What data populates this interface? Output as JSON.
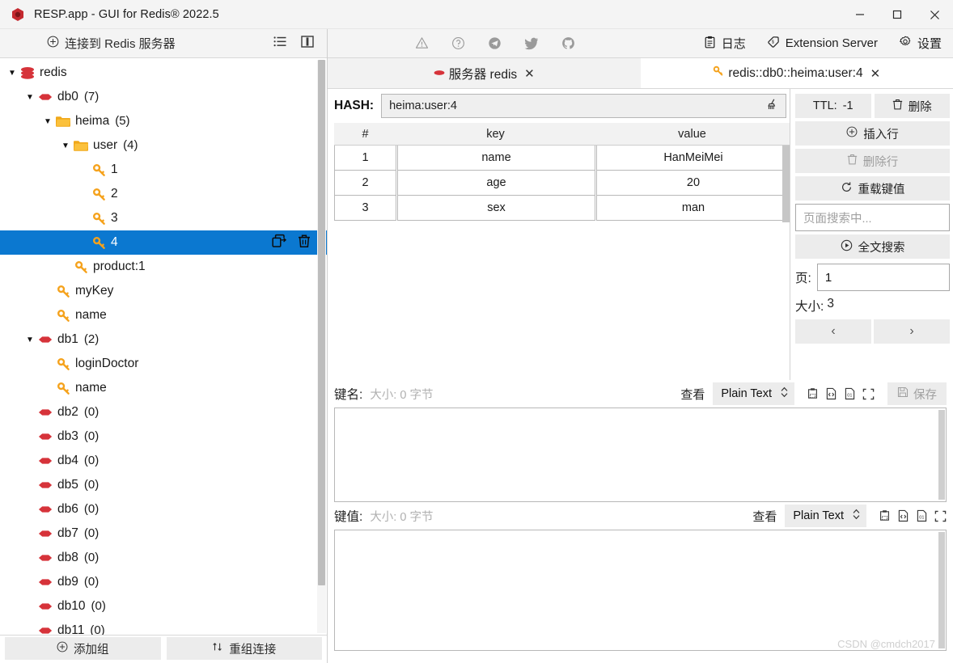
{
  "window": {
    "title": "RESP.app - GUI for Redis® 2022.5",
    "app_icon": "redis-hexagon-icon",
    "controls": {
      "minimize": "─",
      "maximize": "□",
      "close": "✕"
    }
  },
  "sidebar": {
    "connect_label": "连接到 Redis 服务器",
    "connect_icon": "plus-circle-icon",
    "head_icons": [
      "list-view-icon",
      "split-pane-icon"
    ],
    "tree": [
      {
        "label": "redis",
        "count": "",
        "depth": 0,
        "icon": "stack-icon",
        "arrow": "▼",
        "selected": false
      },
      {
        "label": "db0",
        "count": "(7)",
        "depth": 1,
        "icon": "db-icon",
        "arrow": "▼",
        "selected": false
      },
      {
        "label": "heima",
        "count": "(5)",
        "depth": 2,
        "icon": "folder-icon",
        "arrow": "▼",
        "selected": false
      },
      {
        "label": "user",
        "count": "(4)",
        "depth": 3,
        "icon": "folder-icon",
        "arrow": "▼",
        "selected": false
      },
      {
        "label": "1",
        "count": "",
        "depth": 4,
        "icon": "key-icon",
        "arrow": "",
        "selected": false
      },
      {
        "label": "2",
        "count": "",
        "depth": 4,
        "icon": "key-icon",
        "arrow": "",
        "selected": false
      },
      {
        "label": "3",
        "count": "",
        "depth": 4,
        "icon": "key-icon",
        "arrow": "",
        "selected": false
      },
      {
        "label": "4",
        "count": "",
        "depth": 4,
        "icon": "key-icon",
        "arrow": "",
        "selected": true
      },
      {
        "label": "product:1",
        "count": "",
        "depth": 3,
        "icon": "key-icon",
        "arrow": "",
        "selected": false
      },
      {
        "label": "myKey",
        "count": "",
        "depth": 2,
        "icon": "key-icon",
        "arrow": "",
        "selected": false
      },
      {
        "label": "name",
        "count": "",
        "depth": 2,
        "icon": "key-icon",
        "arrow": "",
        "selected": false
      },
      {
        "label": "db1",
        "count": "(2)",
        "depth": 1,
        "icon": "db-icon",
        "arrow": "▼",
        "selected": false
      },
      {
        "label": "loginDoctor",
        "count": "",
        "depth": 2,
        "icon": "key-icon",
        "arrow": "",
        "selected": false
      },
      {
        "label": "name",
        "count": "",
        "depth": 2,
        "icon": "key-icon",
        "arrow": "",
        "selected": false
      },
      {
        "label": "db2",
        "count": "(0)",
        "depth": 1,
        "icon": "db-icon",
        "arrow": "",
        "selected": false
      },
      {
        "label": "db3",
        "count": "(0)",
        "depth": 1,
        "icon": "db-icon",
        "arrow": "",
        "selected": false
      },
      {
        "label": "db4",
        "count": "(0)",
        "depth": 1,
        "icon": "db-icon",
        "arrow": "",
        "selected": false
      },
      {
        "label": "db5",
        "count": "(0)",
        "depth": 1,
        "icon": "db-icon",
        "arrow": "",
        "selected": false
      },
      {
        "label": "db6",
        "count": "(0)",
        "depth": 1,
        "icon": "db-icon",
        "arrow": "",
        "selected": false
      },
      {
        "label": "db7",
        "count": "(0)",
        "depth": 1,
        "icon": "db-icon",
        "arrow": "",
        "selected": false
      },
      {
        "label": "db8",
        "count": "(0)",
        "depth": 1,
        "icon": "db-icon",
        "arrow": "",
        "selected": false
      },
      {
        "label": "db9",
        "count": "(0)",
        "depth": 1,
        "icon": "db-icon",
        "arrow": "",
        "selected": false
      },
      {
        "label": "db10",
        "count": "(0)",
        "depth": 1,
        "icon": "db-icon",
        "arrow": "",
        "selected": false
      },
      {
        "label": "db11",
        "count": "(0)",
        "depth": 1,
        "icon": "db-icon",
        "arrow": "",
        "selected": false
      }
    ],
    "row_actions": [
      "duplicate-icon",
      "trash-icon"
    ],
    "footer": {
      "add_group": "添加组",
      "add_group_icon": "plus-circle-icon",
      "reorder": "重组连接",
      "reorder_icon": "sort-arrows-icon"
    }
  },
  "toolbar": {
    "left_icons": [
      "warning-triangle-icon",
      "help-circle-icon",
      "telegram-icon",
      "twitter-icon",
      "github-icon"
    ],
    "log_label": "日志",
    "log_icon": "clipboard-icon",
    "extension_label": "Extension Server",
    "extension_icon": "extension-icon",
    "settings_label": "设置",
    "settings_icon": "gear-icon"
  },
  "tabs": [
    {
      "label": "服务器 redis",
      "icon": "db-icon",
      "active": false,
      "close": "✕"
    },
    {
      "label": "redis::db0::heima:user:4",
      "icon": "key-icon",
      "active": true,
      "close": "✕"
    }
  ],
  "key_editor": {
    "type_label": "HASH:",
    "key_name": "heima:user:4",
    "key_name_icon": "broom-icon",
    "ttl_label": "TTL:",
    "ttl_value": "-1",
    "delete_label": "删除",
    "delete_icon": "trash-icon",
    "columns": [
      "#",
      "key",
      "value"
    ],
    "rows": [
      {
        "index": "1",
        "key": "name",
        "value": "HanMeiMei"
      },
      {
        "index": "2",
        "key": "age",
        "value": "20"
      },
      {
        "index": "3",
        "key": "sex",
        "value": "man"
      }
    ],
    "actions": {
      "insert_row": "插入行",
      "insert_row_icon": "plus-circle-icon",
      "delete_row": "删除行",
      "delete_row_icon": "trash-icon",
      "reload_value": "重载键值",
      "reload_value_icon": "refresh-icon",
      "search_placeholder": "页面搜索中...",
      "fulltext_search": "全文搜索",
      "fulltext_search_icon": "play-circle-icon",
      "page_label": "页:",
      "page_value": "1",
      "size_label": "大小:",
      "size_value": "3",
      "prev": "‹",
      "next": "›"
    }
  },
  "value_panes": {
    "key_pane": {
      "title": "键名:",
      "size_text": "大小: 0 字节",
      "view_label": "查看",
      "format": "Plain Text",
      "icons": [
        "paste-icon",
        "code-icon",
        "binary-icon",
        "expand-icon"
      ],
      "save_label": "保存",
      "save_icon": "floppy-icon",
      "content": ""
    },
    "value_pane": {
      "title": "键值:",
      "size_text": "大小: 0 字节",
      "view_label": "查看",
      "format": "Plain Text",
      "icons": [
        "paste-icon",
        "code-icon",
        "binary-icon",
        "expand-icon"
      ],
      "content": ""
    }
  },
  "watermark": "CSDN @cmdch2017",
  "colors": {
    "selection": "#0b78d0",
    "key_icon": "#f5a21c",
    "db_icon": "#d6333a",
    "folder_icon": "#f5b120",
    "chrome": "#f4f4f4"
  }
}
